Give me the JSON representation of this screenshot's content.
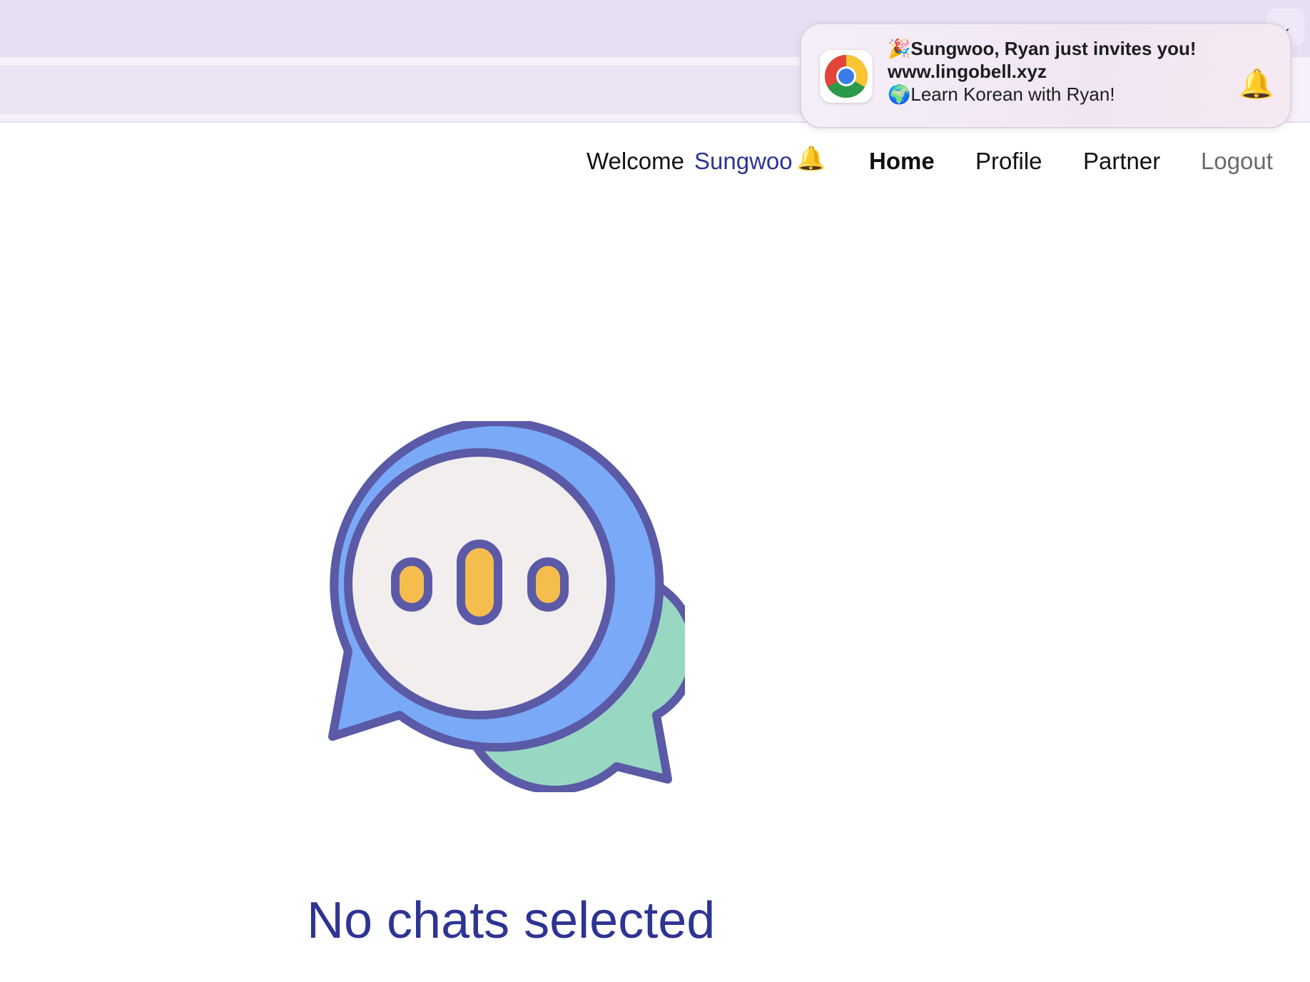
{
  "browser": {
    "tab_menu_icon": "chevron-down-icon"
  },
  "nav": {
    "welcome_label": "Welcome",
    "user_name": "Sungwoo",
    "bell_emoji": "🔔",
    "items": [
      {
        "label": "Home",
        "active": true
      },
      {
        "label": "Profile",
        "active": false
      },
      {
        "label": "Partner",
        "active": false
      },
      {
        "label": "Logout",
        "active": false
      }
    ]
  },
  "main": {
    "empty_state_title": "No chats selected",
    "illustration_icon": "chat-bubbles-icon"
  },
  "notification": {
    "app_icon": "chrome-icon",
    "title": "🎉Sungwoo, Ryan just invites you!",
    "subtitle": "www.lingobell.xyz",
    "body": "🌍Learn Korean with Ryan!",
    "badge_emoji": "🔔"
  },
  "colors": {
    "brand_indigo": "#2e3494",
    "bubble_outline": "#5b5aa6",
    "bubble_blue": "#7aa9f8",
    "bubble_green": "#98d8c3",
    "bubble_face": "#f3eeee",
    "dot_yellow": "#f5bd4d",
    "tab_strip": "#e8dff4"
  }
}
